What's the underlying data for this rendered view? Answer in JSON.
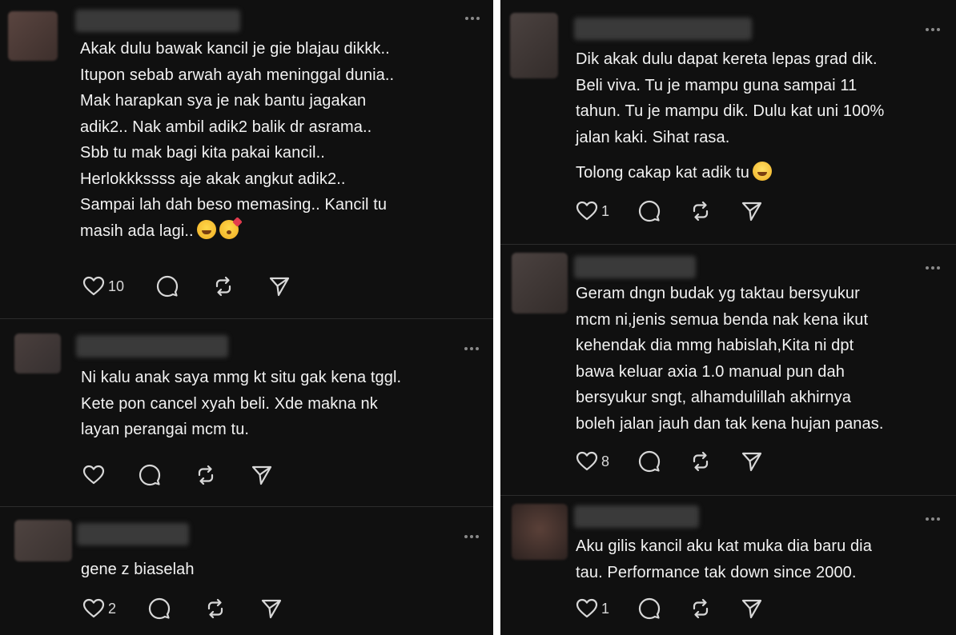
{
  "left_column": [
    {
      "text": "Akak dulu bawak kancil je gie blajau dikkk..\nItupon sebab arwah ayah meninggal dunia..\nMak harapkan sya je nak bantu jagakan\nadik2.. Nak ambil adik2 balik dr asrama..\nSbb tu mak bagi kita pakai kancil..\nHerlokkkssss aje akak angkut adik2..\nSampai lah dah beso memasing.. Kancil tu\nmasih ada lagi..",
      "emojis": [
        "hugging-face-emoji",
        "face-blowing-kiss-emoji"
      ],
      "likes": "10"
    },
    {
      "text": "Ni kalu anak saya mmg kt situ gak kena tggl.\nKete pon cancel xyah beli. Xde makna nk\nlayan perangai mcm tu.",
      "likes": ""
    },
    {
      "text": "gene z biaselah",
      "likes": "2"
    }
  ],
  "right_column": [
    {
      "text": "Dik akak dulu dapat kereta lepas grad dik.\nBeli viva. Tu je mampu guna sampai 11\ntahun. Tu je mampu dik. Dulu kat uni 100%\njalan kaki. Sihat rasa.",
      "text2": "Tolong cakap kat adik tu",
      "emojis": [
        "grinning-sweat-emoji"
      ],
      "likes": "1"
    },
    {
      "text": "Geram dngn budak yg taktau bersyukur\nmcm ni,jenis semua benda nak kena ikut\nkehendak dia mmg habislah,Kita ni dpt\nbawa keluar axia 1.0 manual pun dah\nbersyukur sngt, alhamdulillah akhirnya\nboleh jalan jauh dan tak kena hujan panas.",
      "likes": "8"
    },
    {
      "text": "Aku gilis kancil aku kat muka dia baru dia\ntau. Performance tak down since 2000.",
      "likes": "1"
    }
  ],
  "icons": {
    "like": "heart-icon",
    "reply": "speech-bubble-icon",
    "repost": "repost-arrows-icon",
    "share": "paper-plane-icon",
    "more": "more-dots-icon"
  },
  "colors": {
    "background": "#101010",
    "text": "#f2f2f2",
    "icon": "#d8d8d8",
    "divider": "#2c2c2c"
  }
}
